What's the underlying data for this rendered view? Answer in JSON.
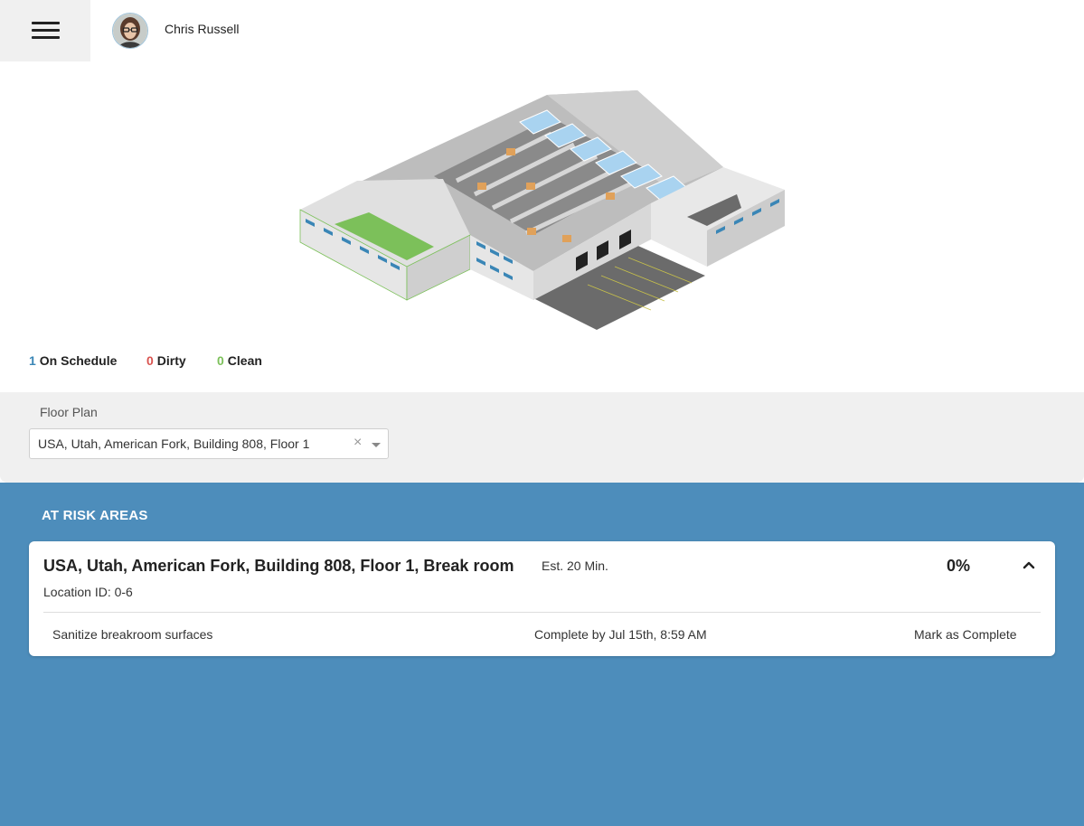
{
  "header": {
    "menu_icon": "hamburger-menu-icon",
    "user_name": "Chris Russell"
  },
  "building_illustration": {
    "icon": "warehouse-isometric-illustration"
  },
  "stats": {
    "on_schedule": {
      "count": "1",
      "label": "On Schedule",
      "color": "#3a86b6"
    },
    "dirty": {
      "count": "0",
      "label": "Dirty",
      "color": "#d9534f"
    },
    "clean": {
      "count": "0",
      "label": "Clean",
      "color": "#7cc05a"
    }
  },
  "filter": {
    "label": "Floor Plan",
    "selected": "USA, Utah, American Fork, Building 808, Floor 1",
    "clear_glyph": "×"
  },
  "at_risk": {
    "title": "AT RISK AREAS",
    "items": [
      {
        "area": "USA, Utah, American Fork, Building 808, Floor 1, Break room",
        "estimate": "Est. 20 Min.",
        "percent": "0%",
        "location": "Location ID: 0-6",
        "tasks": [
          {
            "name": "Sanitize breakroom surfaces",
            "due": "Complete by Jul 15th, 8:59 AM",
            "action": "Mark as Complete"
          }
        ]
      }
    ]
  },
  "colors": {
    "accent_blue": "#4d8dbb",
    "panel_gray": "#f0f0f0"
  }
}
